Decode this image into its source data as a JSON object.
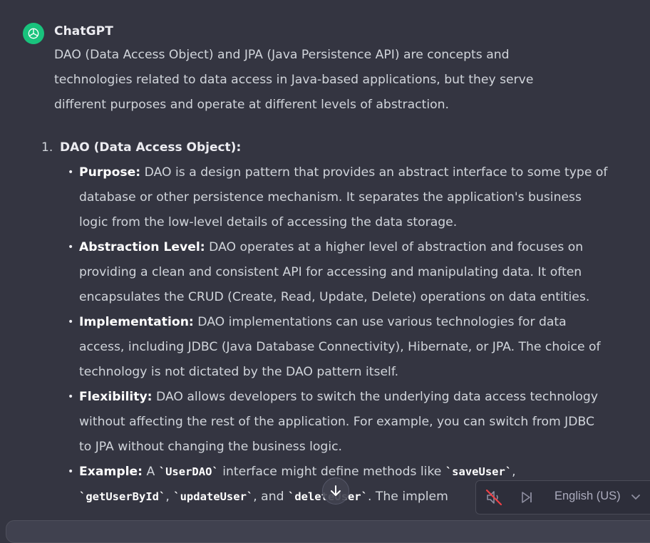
{
  "message": {
    "author": "ChatGPT",
    "intro": "DAO (Data Access Object) and JPA (Java Persistence API) are concepts and technologies related to data access in Java-based applications, but they serve different purposes and operate at different levels of abstraction.",
    "list": {
      "number": "1.",
      "title": "DAO (Data Access Object):",
      "bullets": [
        {
          "label": "Purpose:",
          "text": " DAO is a design pattern that provides an abstract interface to some type of database or other persistence mechanism. It separates the application's business logic from the low-level details of accessing the data storage."
        },
        {
          "label": "Abstraction Level:",
          "text": " DAO operates at a higher level of abstraction and focuses on providing a clean and consistent API for accessing and manipulating data. It often encapsulates the CRUD (Create, Read, Update, Delete) operations on data entities."
        },
        {
          "label": "Implementation:",
          "text": " DAO implementations can use various technologies for data access, including JDBC (Java Database Connectivity), Hibernate, or JPA. The choice of technology is not dictated by the DAO pattern itself."
        },
        {
          "label": "Flexibility:",
          "text": " DAO allows developers to switch the underlying data access technology without affecting the rest of the application. For example, you can switch from JDBC to JPA without changing the business logic."
        }
      ],
      "example": {
        "label": "Example:",
        "t1": " A ",
        "c1": "`UserDAO`",
        "t2": " interface might define methods like ",
        "c2": "`saveUser`",
        "t3": ",",
        "c3": "`getUserById`",
        "t4": ", ",
        "c4": "`updateUser`",
        "t5": ", and ",
        "c5": "`deleteUser`",
        "t6": ". The implem"
      }
    }
  },
  "voice_bar": {
    "language": "English (US)",
    "icons": [
      "mute-icon",
      "skip-icon",
      "chevron-down-icon"
    ]
  },
  "colors": {
    "background": "#343541",
    "avatar": "#19c37d",
    "text": "#d1d5db"
  }
}
